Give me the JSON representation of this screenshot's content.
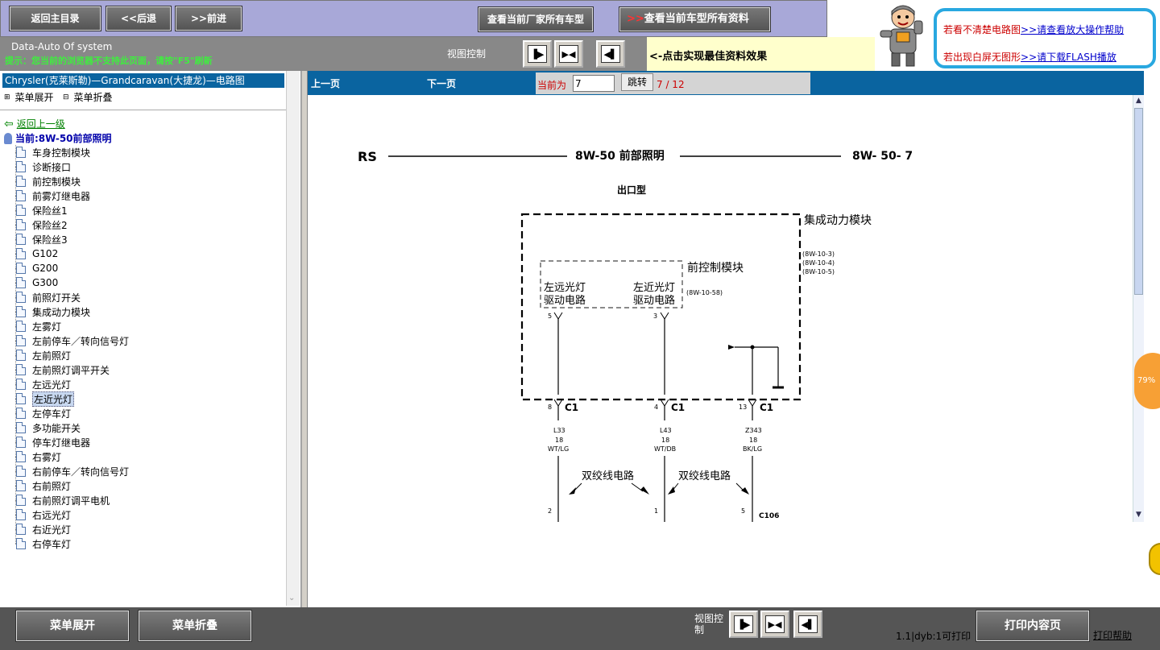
{
  "top": {
    "home_btn": "返回主目录",
    "back_btn": "<<后退",
    "forward_btn": ">>前进",
    "view_models_btn": "查看当前厂家所有车型",
    "view_all_btn_arrow": ">>",
    "view_all_btn": "查看当前车型所有资料",
    "help_line1_text": "若看不清楚电路图",
    "help_line1_link": ">>请查看放大操作帮助",
    "help_line2_text": "若出现白屏无图形",
    "help_line2_link": ">>请下载FLASH播放"
  },
  "sysbar": {
    "title": "Data-Auto Of system",
    "warning": "提示：您当前的浏览器不支持此页面，请按\"F5\"刷新",
    "view_control": "视图控制",
    "hint": "<-点击实现最佳资料效果"
  },
  "left": {
    "header": "Chrysler(克莱斯勒)—Grandcaravan(大捷龙)—电路图",
    "expand": "菜单展开",
    "collapse": "菜单折叠",
    "back_up": "返回上一级",
    "current": "当前:8W-50前部照明",
    "selected_index": 17,
    "items": [
      "车身控制模块",
      "诊断接口",
      "前控制模块",
      "前雾灯继电器",
      "保险丝1",
      "保险丝2",
      "保险丝3",
      "G102",
      "G200",
      "G300",
      "前照灯开关",
      "集成动力模块",
      "左雾灯",
      "左前停车／转向信号灯",
      "左前照灯",
      "左前照灯调平开关",
      "左远光灯",
      "左近光灯",
      "左停车灯",
      "多功能开关",
      "停车灯继电器",
      "右雾灯",
      "右前停车／转向信号灯",
      "右前照灯",
      "右前照灯调平电机",
      "右远光灯",
      "右近光灯",
      "右停车灯"
    ]
  },
  "pager": {
    "prev": "上一页",
    "next": "下一页",
    "current_label": "当前为",
    "page_value": "7",
    "jump_btn": "跳转",
    "page_count": "7 / 12"
  },
  "diagram": {
    "left_code": "RS",
    "title": "8W-50 前部照明",
    "page_code": "8W- 50- 7",
    "subtitle": "出口型",
    "ipm_label": "集成动力模块",
    "ipm_refs": [
      "(8W-10-3)",
      "(8W-10-4)",
      "(8W-10-5)"
    ],
    "fcm_label": "前控制模块",
    "fcm_left_line1": "左远光灯",
    "fcm_left_line2": "驱动电路",
    "fcm_right_line1": "左近光灯",
    "fcm_right_line2": "驱动电路",
    "fcm_ref": "(8W-10-58)",
    "pins_top": [
      "5",
      "3"
    ],
    "connectors": [
      {
        "pin": "8",
        "conn": "C1",
        "wire": "L33",
        "gauge": "18",
        "color": "WT/LG",
        "bottom_pin": "2"
      },
      {
        "pin": "4",
        "conn": "C1",
        "wire": "L43",
        "gauge": "18",
        "color": "WT/DB",
        "bottom_pin": "1"
      },
      {
        "pin": "13",
        "conn": "C1",
        "wire": "Z343",
        "gauge": "18",
        "color": "BK/LG",
        "bottom_pin": "5"
      }
    ],
    "twisted_label": "双绞线电路",
    "bottom_conn": "C106",
    "zoom_badge": "79%"
  },
  "bottom": {
    "expand_btn": "菜单展开",
    "collapse_btn": "菜单折叠",
    "view_control": "视图控制",
    "print_status": "1.1|dyb:1可打印",
    "print_btn": "打印内容页",
    "print_help": "打印帮助"
  }
}
